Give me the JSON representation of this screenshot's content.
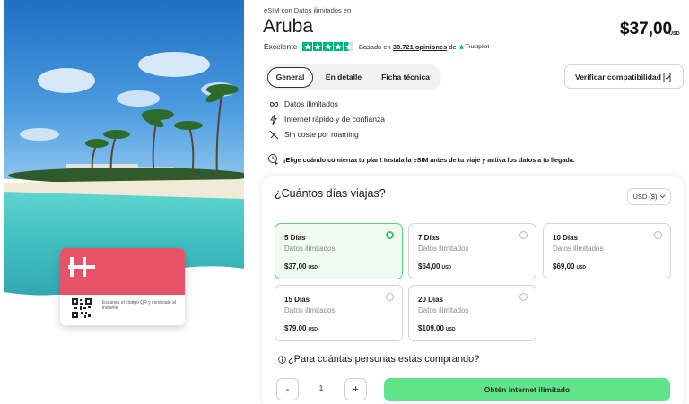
{
  "hero": {
    "card_logo": "H",
    "card_text": "Escanea el código QR y conéctate al instante"
  },
  "header": {
    "breadcrumb": "eSIM con Datos ilimitados en",
    "title": "Aruba",
    "price": "$37,00",
    "price_currency": "USD"
  },
  "rating": {
    "label": "Excelente",
    "stars": 4.5,
    "based_on": "Basado en",
    "reviews": "38.721 opiniones",
    "de": "de",
    "provider": "Trustpilot",
    "star_color": "#00b67a"
  },
  "tabs": [
    {
      "label": "General",
      "active": true
    },
    {
      "label": "En detalle",
      "active": false
    },
    {
      "label": "Ficha técnica",
      "active": false
    }
  ],
  "verify_label": "Verificar compatibilidad",
  "features": [
    {
      "icon": "infinity-icon",
      "label": "Datos ilimitados"
    },
    {
      "icon": "lightning-icon",
      "label": "Internet rápido y de confianza"
    },
    {
      "icon": "no-roaming-icon",
      "label": "Sin coste por roaming"
    }
  ],
  "note": "¡Elige cuándo comienza tu plan! Instala la eSIM antes de tu viaje y activa los datos a tu llegada.",
  "plans_section": {
    "question": "¿Cuántos días viajas?",
    "currency_select": "USD ($)",
    "plans": [
      {
        "days": "5 Días",
        "data": "Datos ilimitados",
        "price": "$37,00",
        "currency": "USD",
        "selected": true
      },
      {
        "days": "7 Días",
        "data": "Datos ilimitados",
        "price": "$64,00",
        "currency": "USD",
        "selected": false
      },
      {
        "days": "10 Días",
        "data": "Datos ilimitados",
        "price": "$69,00",
        "currency": "USD",
        "selected": false
      },
      {
        "days": "15 Días",
        "data": "Datos ilimitados",
        "price": "$79,00",
        "currency": "USD",
        "selected": false
      },
      {
        "days": "20 Días",
        "data": "Datos ilimitados",
        "price": "$109,00",
        "currency": "USD",
        "selected": false
      }
    ]
  },
  "persons": {
    "question": "¿Para cuántas personas estás comprando?",
    "minus": "-",
    "quantity": "1",
    "plus": "+"
  },
  "cta_label": "Obtén internet ilimitado",
  "colors": {
    "accent_green": "#5fe48b",
    "selected_bg": "#effbf2",
    "brand_red": "#e85268"
  }
}
